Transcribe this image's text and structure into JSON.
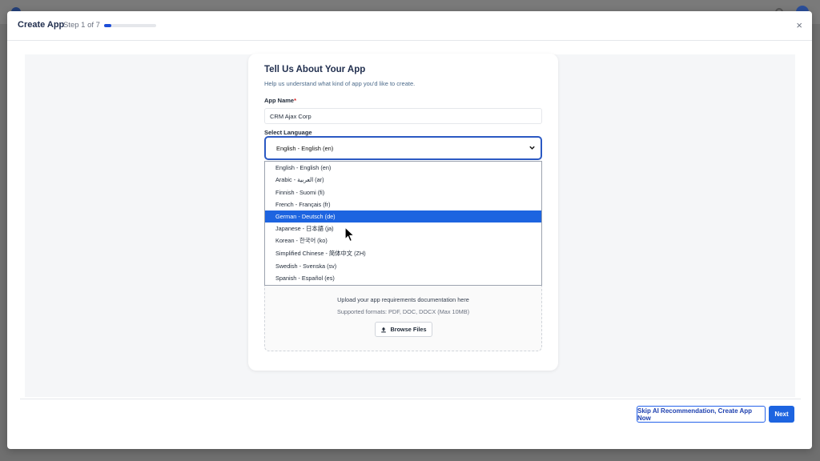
{
  "modal": {
    "title": "Create App",
    "step": "Step 1 of 7",
    "progress_fraction": 0.14,
    "close_icon": "×"
  },
  "card": {
    "title": "Tell Us About Your App",
    "subtitle": "Help us understand what kind of app you'd like to create.",
    "app_name_label": "App Name",
    "required_mark": "*",
    "app_name_value": "CRM Ajax Corp",
    "language_label": "Select Language",
    "language_selected": "English - English (en)"
  },
  "dropdown": {
    "options": [
      "English - English (en)",
      "Arabic - العربية (ar)",
      "Finnish - Suomi (fi)",
      "French - Français (fr)",
      "German - Deutsch (de)",
      "Japanese - 日本語 (ja)",
      "Korean - 한국어 (ko)",
      "Simplified Chinese - 简体中文 (ZH)",
      "Swedish - Svenska (sv)",
      "Spanish - Español (es)"
    ],
    "highlighted_index": 4
  },
  "upload": {
    "text": "Upload your app requirements documentation here",
    "formats": "Supported formats: PDF, DOC, DOCX (Max 10MB)",
    "browse_label": "Browse Files",
    "icon": "upload-icon"
  },
  "footer": {
    "skip_label": "Skip AI Recommendation, Create App Now",
    "next_label": "Next"
  },
  "colors": {
    "primary": "#1d64e0",
    "select_border": "#2b59c3",
    "title_text": "#1f2d4d"
  }
}
